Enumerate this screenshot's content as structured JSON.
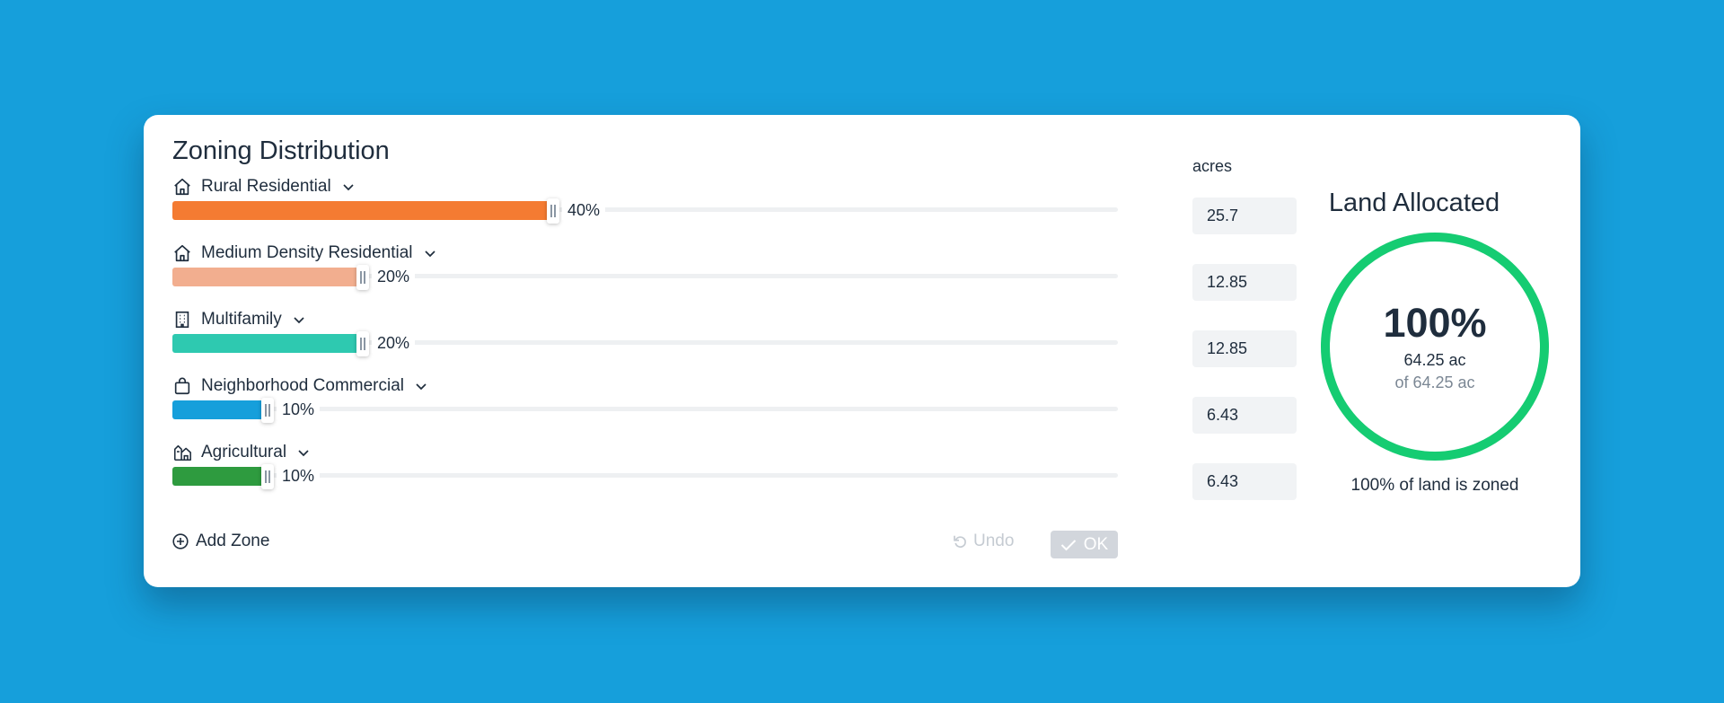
{
  "panel": {
    "title": "Zoning Distribution",
    "acres_header": "acres",
    "add_zone_label": "Add Zone",
    "undo_label": "Undo",
    "ok_label": "OK"
  },
  "zones": [
    {
      "name": "Rural Residential",
      "icon": "house-icon",
      "percent": 40,
      "percent_label": "40%",
      "color": "#f47b32",
      "acres": "25.7"
    },
    {
      "name": "Medium Density Residential",
      "icon": "house-icon",
      "percent": 20,
      "percent_label": "20%",
      "color": "#f2ae8f",
      "acres": "12.85"
    },
    {
      "name": "Multifamily",
      "icon": "building-icon",
      "percent": 20,
      "percent_label": "20%",
      "color": "#2ec9b0",
      "acres": "12.85"
    },
    {
      "name": "Neighborhood Commercial",
      "icon": "shopping-bag-icon",
      "percent": 10,
      "percent_label": "10%",
      "color": "#169fdb",
      "acres": "6.43"
    },
    {
      "name": "Agricultural",
      "icon": "farm-icon",
      "percent": 10,
      "percent_label": "10%",
      "color": "#2e9b3f",
      "acres": "6.43"
    }
  ],
  "allocation": {
    "title": "Land Allocated",
    "percent": 100,
    "percent_label": "100%",
    "acres_line": "64.25 ac",
    "of_line": "of 64.25 ac",
    "summary": "100% of land is zoned",
    "ring_color": "#15cc72"
  }
}
